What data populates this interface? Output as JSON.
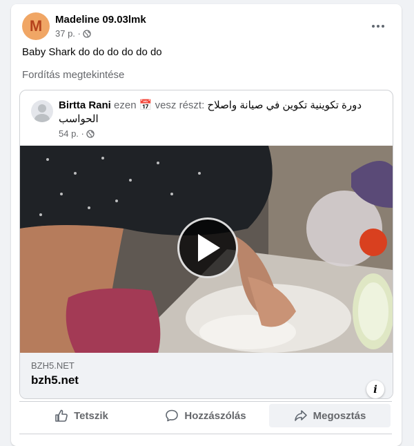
{
  "post": {
    "avatar_letter": "M",
    "author": "Madeline 09.03lmk",
    "time": "37 p. ·",
    "text": "Baby Shark do do do do do do",
    "translate": "Fordítás megtekintése"
  },
  "shared": {
    "author": "Birtta Rani",
    "verb_prefix": "ezen",
    "calendar_emoji": "📅",
    "verb_suffix": "vesz részt:",
    "event_line1": "دورة تكوينية تكوين في صيانة واصلاح",
    "event_line2": "الحواسب",
    "time": "54 p. ·",
    "link_domain": "BZH5.NET",
    "link_title": "bzh5.net",
    "info_label": "i"
  },
  "actions": {
    "like": "Tetszik",
    "comment": "Hozzászólás",
    "share": "Megosztás"
  },
  "colors": {
    "avatar_bg": "#f0a665",
    "avatar_letter": "#b5431c",
    "secondary_text": "#65676b",
    "divider": "#ced0d4"
  }
}
